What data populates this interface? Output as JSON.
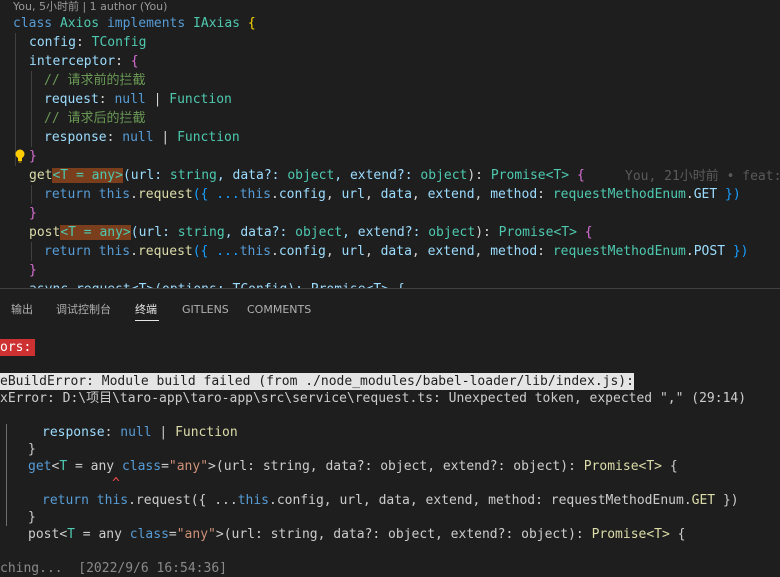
{
  "editor": {
    "codelens": "You, 5小时前 | 1 author (You)",
    "blame": "You, 21小时前 • feat:",
    "lines": {
      "l1": [
        "class",
        "Axios",
        "implements",
        "IAxias",
        "{"
      ],
      "l2": [
        "config",
        ": ",
        "TConfig"
      ],
      "l3": [
        "interceptor",
        ": ",
        "{"
      ],
      "l4": "// 请求前的拦截",
      "l5": [
        "request",
        ": ",
        "null",
        " | ",
        "Function"
      ],
      "l6": "// 请求后的拦截",
      "l7": [
        "response",
        ": ",
        "null",
        " | ",
        "Function"
      ],
      "l8": "}",
      "l9": [
        "get",
        "<T = any>",
        "(url: ",
        "string",
        ", data?: ",
        "object",
        ", extend?: ",
        "object",
        "): ",
        "Promise",
        "<T>",
        " {"
      ],
      "l10": [
        "return",
        "this",
        ".",
        "request",
        "({ ...",
        "this",
        ".",
        "config",
        ", ",
        "url",
        ", ",
        "data",
        ", ",
        "extend",
        ", ",
        "method",
        ": ",
        "requestMethodEnum",
        ".",
        "GET",
        " })"
      ],
      "l11": "}",
      "l12": [
        "post",
        "<T = any>",
        "(url: ",
        "string",
        ", data?: ",
        "object",
        ", extend?: ",
        "object",
        "): ",
        "Promise",
        "<T>",
        " {"
      ],
      "l13": [
        "return",
        "this",
        ".",
        "request",
        "({ ...",
        "this",
        ".",
        "config",
        ", ",
        "url",
        ", ",
        "data",
        ", ",
        "extend",
        ", ",
        "method",
        ": ",
        "requestMethodEnum",
        ".",
        "POST",
        " })"
      ],
      "l14": "}",
      "l15": "async request<T>(options: TConfig): Promise<T> {"
    }
  },
  "panel": {
    "tabs": [
      "输出",
      "调试控制台",
      "终端",
      "GITLENS",
      "COMMENTS"
    ],
    "active_tab": "终端",
    "terminal": {
      "errors_badge": "ors:",
      "build_error": "eBuildError: Module build failed (from ./node_modules/babel-loader/lib/index.js):",
      "syntax_error": "xError: D:\\项目\\taro-app\\taro-app\\src\\service\\request.ts: Unexpected token, expected \",\" (29:14)",
      "snippet": {
        "s1": [
          "response",
          ": ",
          "null",
          " | ",
          "Function"
        ],
        "s2": "}",
        "s3": [
          "get",
          "<",
          "T",
          " = any ",
          "class",
          "=",
          "\"any\"",
          ">(url: string, data?: object, extend?: object): ",
          "Promise",
          "<T>",
          " {"
        ],
        "s4": "^",
        "s5": [
          "return",
          "this",
          ".request({ ...",
          "this",
          ".config, url, data, extend, method: requestMethodEnum.",
          "GET",
          " })"
        ],
        "s6": "}",
        "s7": [
          "post",
          "<",
          "T",
          " = any ",
          "class",
          "=",
          "\"any\"",
          ">(url: string, data?: object, extend?: object): ",
          "Promise",
          "<T>",
          " {"
        ]
      },
      "footer": "ching...  [2022/9/6 16:54:36]"
    }
  },
  "colors": {
    "background": "#1e1e1e",
    "error_badge": "#cd3131",
    "keyword": "#569cd6",
    "type": "#4ec9b0",
    "function": "#dcdcaa",
    "comment": "#6a9955",
    "string": "#ce9178"
  }
}
